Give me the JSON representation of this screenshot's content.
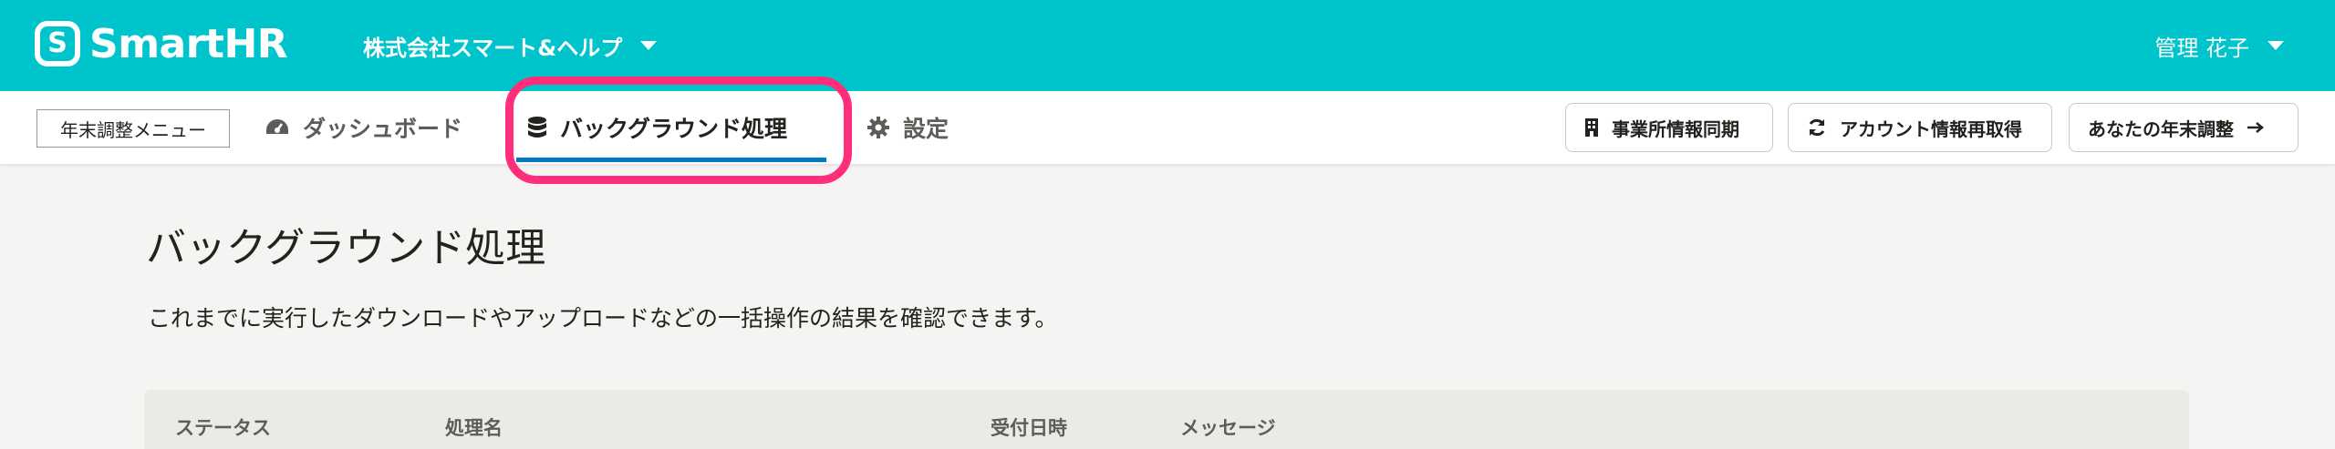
{
  "header": {
    "logo_mark": "S",
    "logo_text": "SmartHR",
    "company_name": "株式会社スマート&ヘルプ",
    "user_name": "管理 花子"
  },
  "nav": {
    "menu_label": "年末調整メニュー",
    "tabs": [
      {
        "label": "ダッシュボード",
        "icon": "dashboard-icon"
      },
      {
        "label": "バックグラウンド処理",
        "icon": "database-icon",
        "active": true
      },
      {
        "label": "設定",
        "icon": "gear-icon"
      }
    ],
    "buttons": {
      "office_sync": "事業所情報同期",
      "account_refetch": "アカウント情報再取得",
      "your_yearend": "あなたの年末調整"
    }
  },
  "main": {
    "title": "バックグラウンド処理",
    "description": "これまでに実行したダウンロードやアップロードなどの一括操作の結果を確認できます。",
    "table": {
      "columns": [
        "ステータス",
        "処理名",
        "受付日時",
        "メッセージ"
      ]
    }
  },
  "colors": {
    "header_bg": "#00c4cc",
    "active_underline": "#0077c7",
    "annotation_highlight": "#ff2e7a",
    "page_bg": "#f5f4f3"
  }
}
